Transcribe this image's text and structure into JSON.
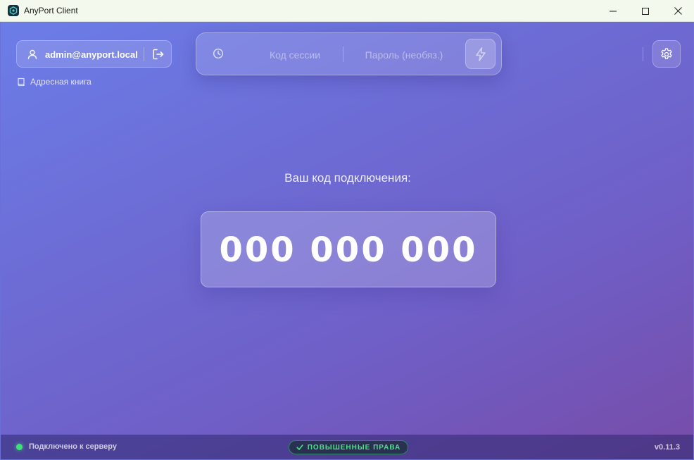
{
  "window": {
    "title": "AnyPort Client"
  },
  "user": {
    "email": "admin@anyport.local"
  },
  "address_book": {
    "label": "Адресная книга"
  },
  "session": {
    "code_placeholder": "Код сессии",
    "password_placeholder": "Пароль (необяз.)"
  },
  "connection": {
    "title": "Ваш код подключения:",
    "code": "000 000 000"
  },
  "status": {
    "text": "Подключено к серверу",
    "badge": "ПОВЫШЕННЫЕ ПРАВА",
    "version": "v0.11.3",
    "color": "#3ee07a"
  },
  "icons": [
    "app-logo-icon",
    "minimize-icon",
    "maximize-icon",
    "close-icon",
    "user-icon",
    "logout-icon",
    "book-icon",
    "history-icon",
    "lightning-icon",
    "gear-icon",
    "check-icon"
  ]
}
